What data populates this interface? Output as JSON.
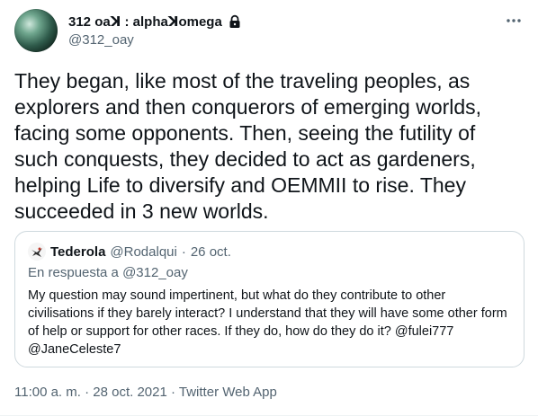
{
  "author": {
    "display_name": "312 oaꓘ : alphaꓘomega",
    "handle": "@312_oay",
    "icons": {
      "lock": "lock-icon",
      "more": "more-icon"
    }
  },
  "tweet": {
    "text": "They began, like most of the traveling peoples, as explorers and then conquerors of emerging worlds, facing some opponents. Then, seeing the futility of such conquests, they decided to act as gardeners, helping Life to diversify and OEMMII to rise. They succeeded in 3 new worlds."
  },
  "quote": {
    "name": "Tederola",
    "handle": "@Rodalqui",
    "separator": "·",
    "date": "26 oct.",
    "reply_to": "En respuesta a @312_oay",
    "text": "My question may sound impertinent, but what do they contribute to other civilisations if they barely interact? I understand that they will have some other form of help or support for other races. If they do, how do they do it? @fulei777 @JaneCeleste7"
  },
  "meta": {
    "timestamp": "11:00 a. m. · 28 oct. 2021 · Twitter Web App"
  },
  "colors": {
    "text": "#0f1419",
    "secondary": "#536471",
    "border": "#cfd9de"
  }
}
